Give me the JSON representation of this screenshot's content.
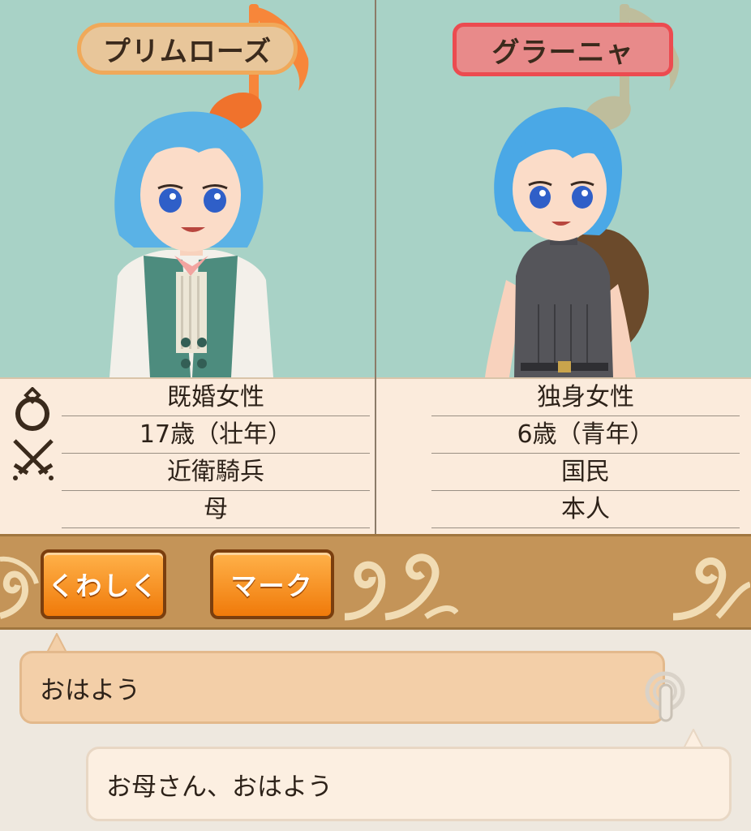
{
  "left_character": {
    "name": "プリムローズ",
    "stats": [
      "既婚女性",
      "17歳（壮年）",
      "近衛騎兵",
      "母"
    ]
  },
  "right_character": {
    "name": "グラーニャ",
    "stats": [
      "独身女性",
      "6歳（青年）",
      "国民",
      "本人"
    ]
  },
  "icons": {
    "marriage": "ring-icon",
    "occupation": "crossed-swords-icon",
    "emote": "music-note-icon",
    "hint": "finger-tap-icon"
  },
  "actions": {
    "detail_label": "くわしく",
    "mark_label": "マーク"
  },
  "dialogue": {
    "line_1": "おはよう",
    "line_2": "お母さん、おはよう"
  },
  "colors": {
    "portrait_bg": "#a8d2c6",
    "left_name_border": "#f0a95a",
    "right_name_border": "#ec4b50",
    "button_orange": "#f07a0a",
    "bar_brown": "#c49458"
  }
}
